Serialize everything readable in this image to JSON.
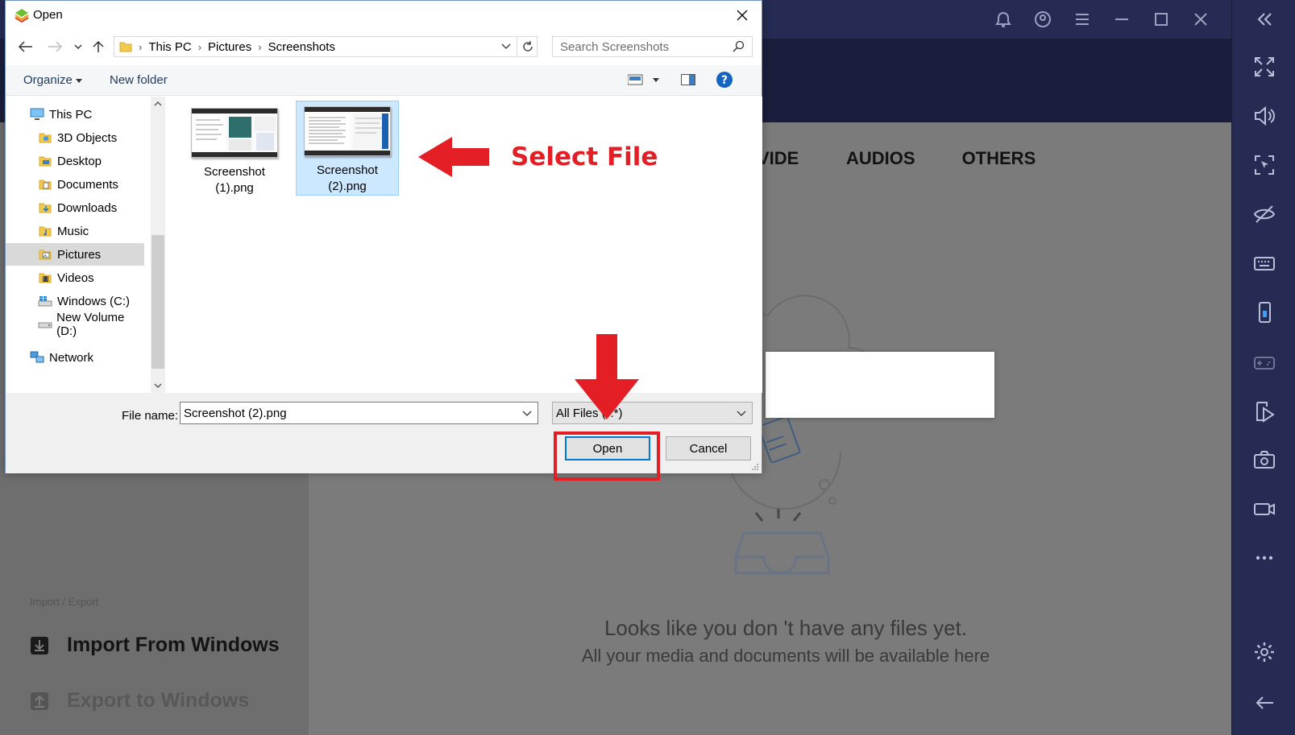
{
  "background_app": {
    "tabs": [
      "VIDEOS",
      "AUDIOS",
      "OTHERS"
    ],
    "empty_state": {
      "line1": "Looks like you don 't have any files yet.",
      "line2": "All your media and documents will be available here"
    },
    "import_export": {
      "heading": "Import / Export",
      "import_label": "Import From Windows",
      "export_label": "Export to Windows"
    }
  },
  "dialog": {
    "title": "Open",
    "breadcrumb": [
      "This PC",
      "Pictures",
      "Screenshots"
    ],
    "search_placeholder": "Search Screenshots",
    "toolbar": {
      "organize": "Organize",
      "new_folder": "New folder"
    },
    "nav_items": [
      {
        "label": "This PC",
        "icon": "computer-icon"
      },
      {
        "label": "3D Objects",
        "icon": "folder-3d-icon"
      },
      {
        "label": "Desktop",
        "icon": "folder-desktop-icon"
      },
      {
        "label": "Documents",
        "icon": "folder-documents-icon"
      },
      {
        "label": "Downloads",
        "icon": "folder-downloads-icon"
      },
      {
        "label": "Music",
        "icon": "folder-music-icon"
      },
      {
        "label": "Pictures",
        "icon": "folder-pictures-icon",
        "selected": true
      },
      {
        "label": "Videos",
        "icon": "folder-videos-icon"
      },
      {
        "label": "Windows (C:)",
        "icon": "drive-c-icon"
      },
      {
        "label": "New Volume (D:)",
        "icon": "drive-d-icon"
      },
      {
        "label": "Network",
        "icon": "network-icon"
      }
    ],
    "files": [
      {
        "name": "Screenshot (1).png",
        "selected": false
      },
      {
        "name": "Screenshot (2).png",
        "selected": true
      }
    ],
    "file_name_label": "File name:",
    "file_name_value": "Screenshot (2).png",
    "file_type_value": "All Files (*.*)",
    "open_label": "Open",
    "cancel_label": "Cancel"
  },
  "annotation": {
    "text": "Select File",
    "color": "#e31e25"
  },
  "colors": {
    "app_dark": "#262b53",
    "selection": "#cce8ff",
    "accent": "#0078d7"
  }
}
